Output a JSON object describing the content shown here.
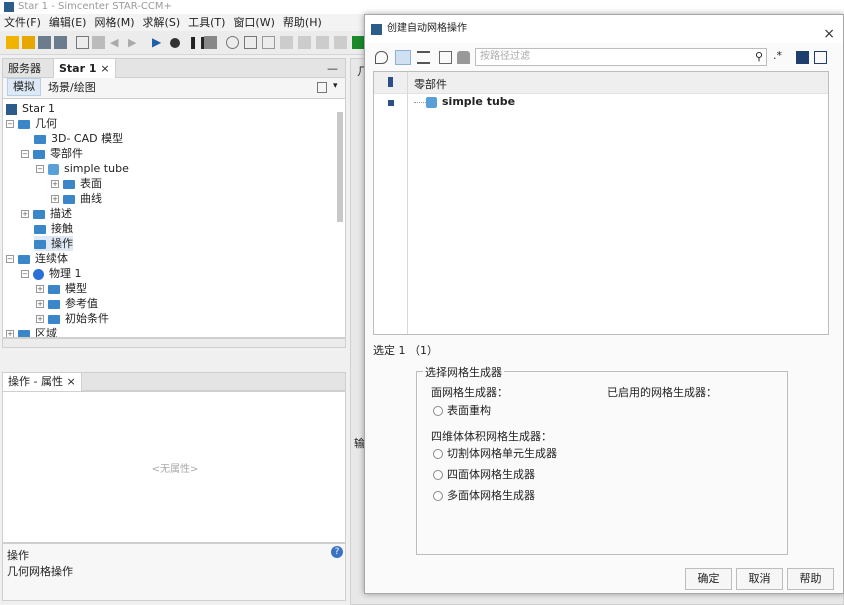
{
  "window": {
    "title": "Star 1 - Simcenter STAR-CCM+"
  },
  "menu": [
    "文件(F)",
    "编辑(E)",
    "网格(M)",
    "求解(S)",
    "工具(T)",
    "窗口(W)",
    "帮助(H)"
  ],
  "left_panel": {
    "tabs": {
      "server": "服务器",
      "star1": "Star 1",
      "close": "×",
      "minimize": "—"
    },
    "subtabs": {
      "sim": "模拟",
      "scene": "场景/绘图"
    },
    "tree": {
      "root": "Star 1",
      "geometry": "几何",
      "cad": "3D- CAD 模型",
      "parts": "零部件",
      "simple_tube": "simple tube",
      "surfaces": "表面",
      "curves": "曲线",
      "descriptions": "描述",
      "contacts": "接触",
      "operations": "操作",
      "continua": "连续体",
      "physics1": "物理 1",
      "models": "模型",
      "reference": "参考值",
      "initial": "初始条件",
      "regions": "区域"
    }
  },
  "props_panel": {
    "tab": "操作 - 属性",
    "close": "×",
    "empty": "<无属性>",
    "help_title": "操作",
    "help_text": "几何网格操作"
  },
  "background_labels": {
    "top": "几",
    "mid": "输"
  },
  "dialog": {
    "title": "创建自动网格操作",
    "close": "×",
    "filter_placeholder": "按路径过滤",
    "tree_header": "零部件",
    "tree_item": "simple tube",
    "selected": "选定 1 （1）",
    "group_title": "选择网格生成器",
    "surface_label": "面网格生成器：",
    "enabled_label": "已启用的网格生成器：",
    "surface_options": [
      "表面重构"
    ],
    "volume_label": "四维体体积网格生成器：",
    "volume_options": [
      "切割体网格单元生成器",
      "四面体网格生成器",
      "多面体网格生成器"
    ],
    "buttons": {
      "ok": "确定",
      "cancel": "取消",
      "help": "帮助"
    }
  }
}
